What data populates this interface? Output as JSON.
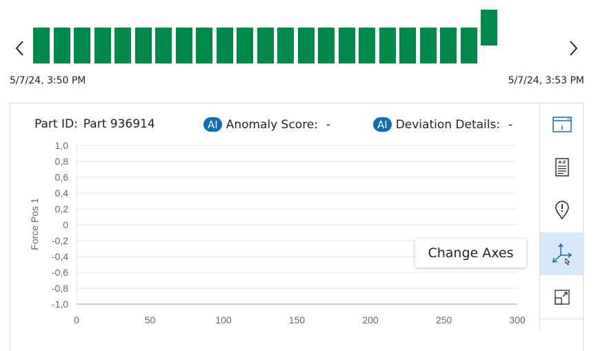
{
  "timeline": {
    "start_time": "5/7/24, 3:50 PM",
    "end_time": "5/7/24, 3:53 PM",
    "bar_color": "#00884a",
    "bar_count": 23,
    "selected_bar_index": 22
  },
  "chart_header": {
    "part_id_label": "Part ID:",
    "part_id_value": "Part 936914",
    "ai_badge": "AI",
    "anomaly_label": "Anomaly Score:",
    "anomaly_value": "-",
    "deviation_label": "Deviation Details:",
    "deviation_value": "-"
  },
  "chart_data": {
    "type": "line",
    "ylabel": "Force Pos 1",
    "xlabel": "",
    "xlim": [
      0,
      300
    ],
    "ylim": [
      -1.0,
      1.0
    ],
    "x_ticks": [
      "0",
      "50",
      "100",
      "150",
      "200",
      "250",
      "300"
    ],
    "y_ticks": [
      "1,0",
      "0,8",
      "0,6",
      "0,4",
      "0,2",
      "0",
      "-0,2",
      "-0,4",
      "-0,6",
      "-0,8",
      "-1,0"
    ],
    "grid": true,
    "series": []
  },
  "toolbar": {
    "tooltip": "Change Axes",
    "accent_color": "#0a6fb5",
    "active_bg": "#d9e8f8",
    "buttons": [
      {
        "icon": "window-info-icon"
      },
      {
        "icon": "document-az-icon"
      },
      {
        "icon": "location-alert-icon"
      },
      {
        "icon": "axes-icon"
      },
      {
        "icon": "expand-icon"
      }
    ]
  }
}
